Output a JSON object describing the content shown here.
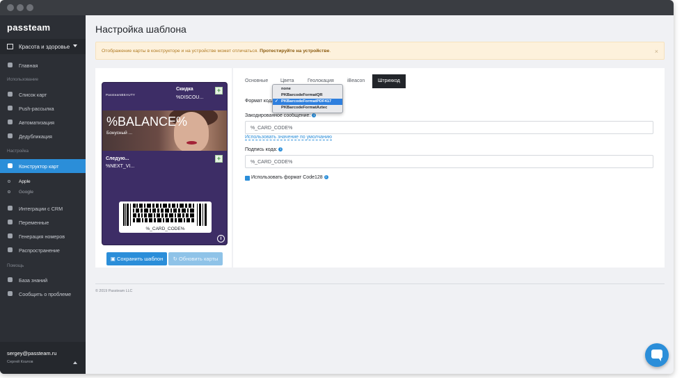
{
  "app": {
    "logo": "passteam"
  },
  "sidebar": {
    "organization": "Красота и здоровье",
    "home": "Главная",
    "section_usage": "Использование",
    "usage_items": [
      "Список карт",
      "Push-рассылка",
      "Автоматизация",
      "Дедубликация"
    ],
    "section_settings": "Настройка",
    "active_item": "Конструктор карт",
    "sub_items": [
      "Apple",
      "Google"
    ],
    "settings_items": [
      "Интеграции с CRM",
      "Переменные",
      "Генерация номеров",
      "Распространение"
    ],
    "section_help": "Помощь",
    "help_items": [
      "База знаний",
      "Сообщить о проблеме"
    ],
    "user_email": "sergey@passteam.ru",
    "user_name": "Сергей Козлов"
  },
  "page": {
    "title": "Настройка шаблона",
    "alert_text": "Отображение карты в конструкторе и на устройстве может отличаться.",
    "alert_bold": "Протестируйте на устройстве",
    "alert_close": "×"
  },
  "card": {
    "brand": "PassteamBEAUTY",
    "header_label": "Скидка",
    "header_value": "%DISCOU...",
    "primary_value": "%BALANCE%",
    "primary_label": "Бонусный ...",
    "secondary_label": "Следую...",
    "secondary_value": "%NEXT_VI...",
    "barcode_text": "%_CARD_CODE%",
    "plus": "+",
    "info": "i"
  },
  "buttons": {
    "save": "Сохранить шаблон",
    "update": "Обновить карты"
  },
  "tabs": [
    "Основные",
    "Цвета",
    "Геолокация",
    "iBeacon",
    "Штрихкод"
  ],
  "form": {
    "format_label": "Формат кода",
    "dropdown_options": [
      "none",
      "PKBarcodeFormatQR",
      "PKBarcodeFormatPDF417",
      "PKBarcodeFormatAztec"
    ],
    "dropdown_selected": "PKBarcodeFormatPDF417",
    "checkmark": "✓",
    "encoded_label": "Закодированное сообщение:",
    "encoded_value": "%_CARD_CODE%",
    "default_link": "Использовать значение по умолчанию",
    "signature_label": "Подпись кода:",
    "signature_value": "%_CARD_CODE%",
    "code128_label": "Использовать формат Code128"
  },
  "footer": {
    "copyright": "© 2019 Passteam LLC"
  },
  "colors": {
    "accent": "#2b8ed9",
    "sidebar": "#2c2f35",
    "card": "#3d2d66"
  }
}
